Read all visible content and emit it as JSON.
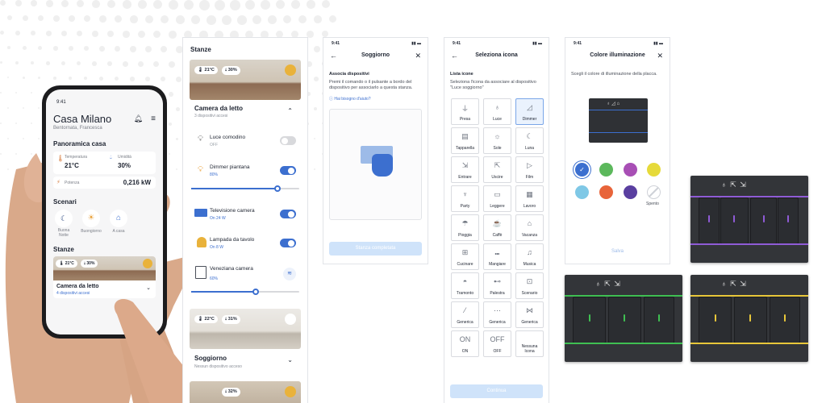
{
  "phone": {
    "time": "9:41",
    "title": "Casa Milano",
    "subtitle": "Bentornata, Francesca",
    "overview_heading": "Panoramica casa",
    "temperature": {
      "label": "Temperatura",
      "value": "21°C"
    },
    "humidity": {
      "label": "Umidità",
      "value": "30%"
    },
    "power": {
      "label": "Potenza",
      "value": "0,216 kW"
    },
    "scenes_heading": "Scenari",
    "scenes": [
      "Buona Notte",
      "Buongiorno",
      "A casa"
    ],
    "rooms_heading": "Stanze",
    "room": {
      "temp": "21°C",
      "humidity": "30%",
      "name": "Camera da letto",
      "sub": "4 dispositivi accesi"
    }
  },
  "rooms_panel": {
    "title": "Stanze",
    "room1": {
      "temp": "21°C",
      "humidity": "30%",
      "name": "Camera da letto",
      "sub": "3 dispositivi accesi"
    },
    "devices": [
      {
        "name": "Luce comodino",
        "sub": "OFF"
      },
      {
        "name": "Dimmer piantana",
        "sub": "80%"
      },
      {
        "name": "Televisione camera",
        "sub": "On  24 W"
      },
      {
        "name": "Lampada da tavolo",
        "sub": "On  8 W"
      },
      {
        "name": "Veneziana camera",
        "sub": "60%"
      }
    ],
    "room2": {
      "temp": "22°C",
      "humidity": "31%",
      "name": "Soggiorno",
      "sub": "Nessun dispositivo acceso"
    },
    "room3": {
      "humidity": "32%"
    }
  },
  "soggiorno_panel": {
    "time": "9:41",
    "back": "←",
    "title": "Soggiorno",
    "close": "✕",
    "heading": "Associa dispositivi",
    "text": "Premi il comando o il pulsante a bordo del dispositivo per associarlo a questa stanza.",
    "help": "Hai bisogno d'aiuto?",
    "button": "Stanza completata"
  },
  "icon_panel": {
    "time": "9:41",
    "back": "←",
    "title": "Seleziona icona",
    "heading": "Lista icone",
    "text": "Seleziona l'icona da associare al dispositivo \"Luce soggiorno\"",
    "icons": [
      {
        "label": "Presa",
        "glyph": "⏚"
      },
      {
        "label": "Luce",
        "glyph": "♁"
      },
      {
        "label": "Dimmer",
        "glyph": "◿"
      },
      {
        "label": "Tapparella",
        "glyph": "▤"
      },
      {
        "label": "Sole",
        "glyph": "☼"
      },
      {
        "label": "Luna",
        "glyph": "☾"
      },
      {
        "label": "Entrare",
        "glyph": "⇲"
      },
      {
        "label": "Uscire",
        "glyph": "⇱"
      },
      {
        "label": "Film",
        "glyph": "▷"
      },
      {
        "label": "Party",
        "glyph": "♆"
      },
      {
        "label": "Leggere",
        "glyph": "▭"
      },
      {
        "label": "Lavoro",
        "glyph": "▦"
      },
      {
        "label": "Pioggia",
        "glyph": "☂"
      },
      {
        "label": "Caffè",
        "glyph": "☕"
      },
      {
        "label": "Vacanza",
        "glyph": "⌂"
      },
      {
        "label": "Cucinare",
        "glyph": "⊞"
      },
      {
        "label": "Mangiare",
        "glyph": "⑉"
      },
      {
        "label": "Musica",
        "glyph": "♫"
      },
      {
        "label": "Tramonto",
        "glyph": "◓"
      },
      {
        "label": "Palestra",
        "glyph": "⊷"
      },
      {
        "label": "Scenario",
        "glyph": "⊡"
      },
      {
        "label": "Generica",
        "glyph": "⁄"
      },
      {
        "label": "Generica",
        "glyph": "⋯"
      },
      {
        "label": "Generica",
        "glyph": "⋈"
      },
      {
        "label": "ON",
        "glyph": "ON"
      },
      {
        "label": "OFF",
        "glyph": "OFF"
      },
      {
        "label": "Nessuna Icona",
        "glyph": ""
      }
    ],
    "button": "Continua"
  },
  "color_panel": {
    "time": "9:41",
    "title": "Colore illuminazione",
    "close": "✕",
    "text": "Scegli il colore di illuminazione della placca.",
    "off_label": "Spento",
    "colors": [
      "#3c6fcf",
      "#5cb85c",
      "#a84fb5",
      "#e6da3a",
      "#7fc8e6",
      "#e8643a",
      "#5a3fa0"
    ],
    "button": "Salva"
  },
  "plates": {
    "colors": [
      "#8f5bd6",
      "#3fbf52",
      "#e8c73a"
    ]
  }
}
